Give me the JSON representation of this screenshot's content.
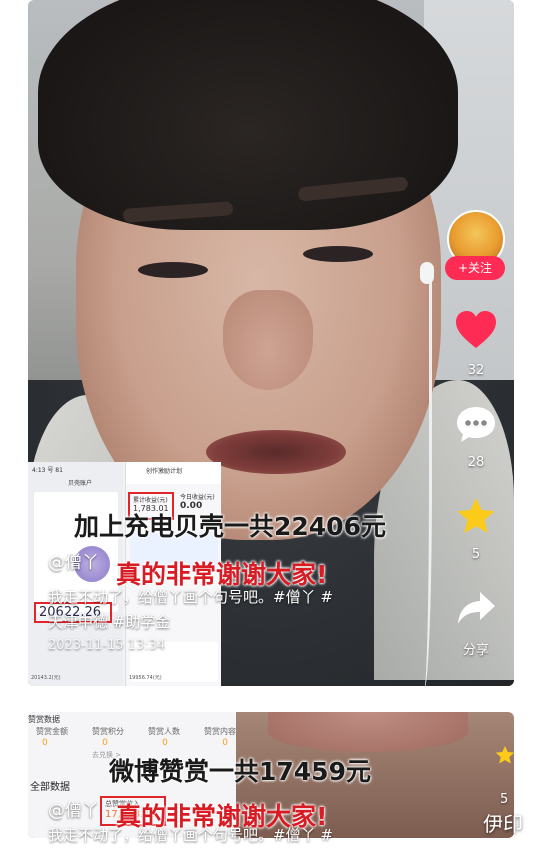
{
  "video1": {
    "captions": {
      "main": "加上充电贝壳一共22406元",
      "thanks": "真的非常谢谢大家!"
    },
    "author": "@僧丫",
    "description_line1": "我走不动了，给僧丫画个句号吧。#僧丫 #",
    "description_line2": "天津中德 #助学金",
    "timestamp": "2023-11-15 13:34",
    "screenshot": {
      "status": "4:13 号 81",
      "left_title": "贝壳账户",
      "left_amount": "20622.26",
      "left_footer": "20143.2(元)",
      "left_footer_2": "19956.74(元)",
      "right_title": "创作激励计划",
      "right_label": "累计收益(元)",
      "right_amount": "1,783.01",
      "right_label_2": "今日收益(元)",
      "right_amount_2": "0.00"
    },
    "actions": {
      "follow_label": "+关注",
      "like_count": "32",
      "comment_count": "28",
      "favorite_count": "5",
      "share_label": "分享"
    },
    "colors": {
      "follow": "#fe2c55",
      "like": "#fe2c55",
      "favorite": "#fccb1a",
      "caption_red": "#d81c24"
    }
  },
  "video2": {
    "captions": {
      "main": "微博赞赏一共17459元",
      "thanks": "真的非常谢谢大家!"
    },
    "author": "@僧丫",
    "description": "我走不动了，给僧丫画个句号吧。#僧丫 #",
    "stats_header": "赞赏数据",
    "stats_labels": [
      "赞赏金额",
      "赞赏积分",
      "赞赏人数",
      "赞赏内容"
    ],
    "stats_values": [
      "0",
      "0",
      "0",
      "0"
    ],
    "stats_link": "去兑换 >",
    "section_title": "全部数据",
    "box_label": "总赞赏收入",
    "box_value": "17,458.22",
    "favorite_count": "5"
  },
  "watermark": "伊印",
  "icons": [
    "heart-icon",
    "comment-icon",
    "star-icon",
    "share-icon"
  ]
}
